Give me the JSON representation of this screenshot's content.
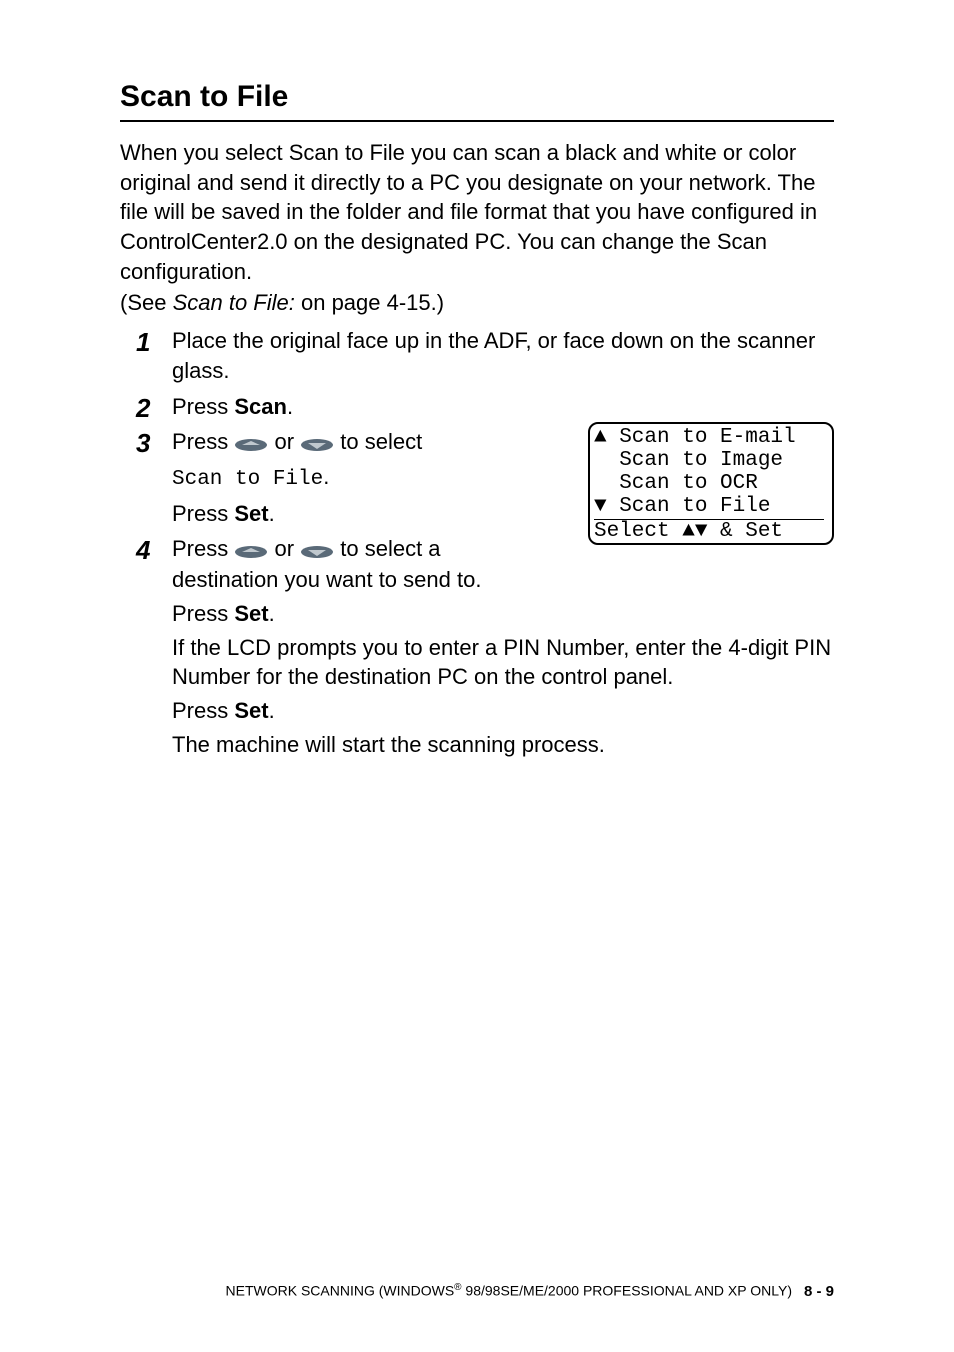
{
  "heading": "Scan to File",
  "intro": "When you select Scan to File you can scan a black and white or color original and send it directly to a PC you designate on your network. The file will be saved in the folder and file format that you have configured in ControlCenter2.0 on the designated PC. You can change the Scan configuration.",
  "see_prefix": "(See ",
  "see_italic": "Scan to File:",
  "see_suffix": " on page 4-15.)",
  "steps": {
    "s1": {
      "num": "1",
      "text": "Place the original face up in the ADF, or face down on the scanner glass."
    },
    "s2": {
      "num": "2",
      "press": "Press ",
      "scan": "Scan",
      "period": "."
    },
    "s3": {
      "num": "3",
      "press_a": "Press ",
      "or": " or ",
      "to_select": " to select",
      "mono_line": "Scan to File",
      "mono_period": ".",
      "press_b": "Press ",
      "set": "Set",
      "period": "."
    },
    "s4": {
      "num": "4",
      "press_a": "Press ",
      "or": " or ",
      "to_select_a": " to select a destination you want to send to.",
      "press_b": "Press ",
      "set1": "Set",
      "period1": ".",
      "pin_text": "If the LCD prompts you to enter a PIN Number, enter the 4-digit PIN Number for the destination PC on the control panel.",
      "press_c": "Press ",
      "set2": "Set",
      "period2": ".",
      "final": "The machine will start the scanning process."
    }
  },
  "lcd": {
    "r1": "▲ Scan to E-mail",
    "r2": "  Scan to Image",
    "r3": "  Scan to OCR",
    "r4": "▼ Scan to File",
    "r5": "Select ▲▼ & Set"
  },
  "footer": {
    "text_a": "NETWORK SCANNING (WINDOWS",
    "reg": "®",
    "text_b": " 98/98SE/ME/2000 PROFESSIONAL AND XP ONLY)",
    "page": "8 - 9"
  }
}
